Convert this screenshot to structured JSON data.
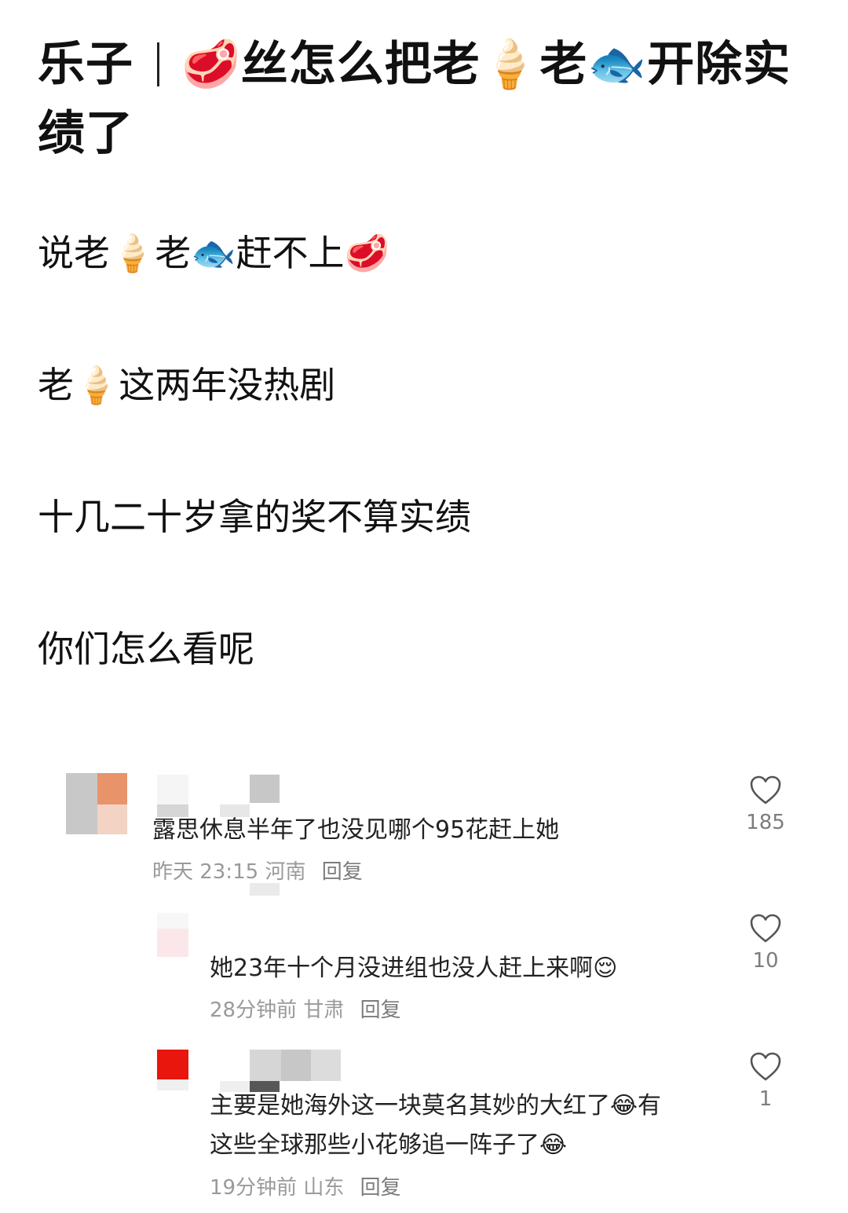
{
  "post": {
    "title_part1": "乐子",
    "title_part2": "🥩丝怎么把老🍦老🐟开除实绩了",
    "lines": [
      "说老🍦老🐟赶不上🥩",
      "老🍦这两年没热剧",
      "十几二十岁拿的奖不算实绩",
      "你们怎么看呢"
    ]
  },
  "comments": [
    {
      "text": "露思休息半年了也没见哪个95花赶上她",
      "time": "昨天 23:15",
      "location": "河南",
      "reply": "回复",
      "likes": "185"
    },
    {
      "text": "她23年十个月没进组也没人赶上来啊😌",
      "time": "28分钟前",
      "location": "甘肃",
      "reply": "回复",
      "likes": "10"
    },
    {
      "text_line1": "主要是她海外这一块莫名其妙的大红了😂有",
      "text_line2": "这些全球那些小花够追一阵子了😂",
      "time": "19分钟前",
      "location": "山东",
      "reply": "回复",
      "likes": "1"
    }
  ],
  "colors": {
    "text": "#111111",
    "meta": "#9a9a9a",
    "avatar_red": "#e8160c",
    "avatar_orange": "#e9936b"
  }
}
